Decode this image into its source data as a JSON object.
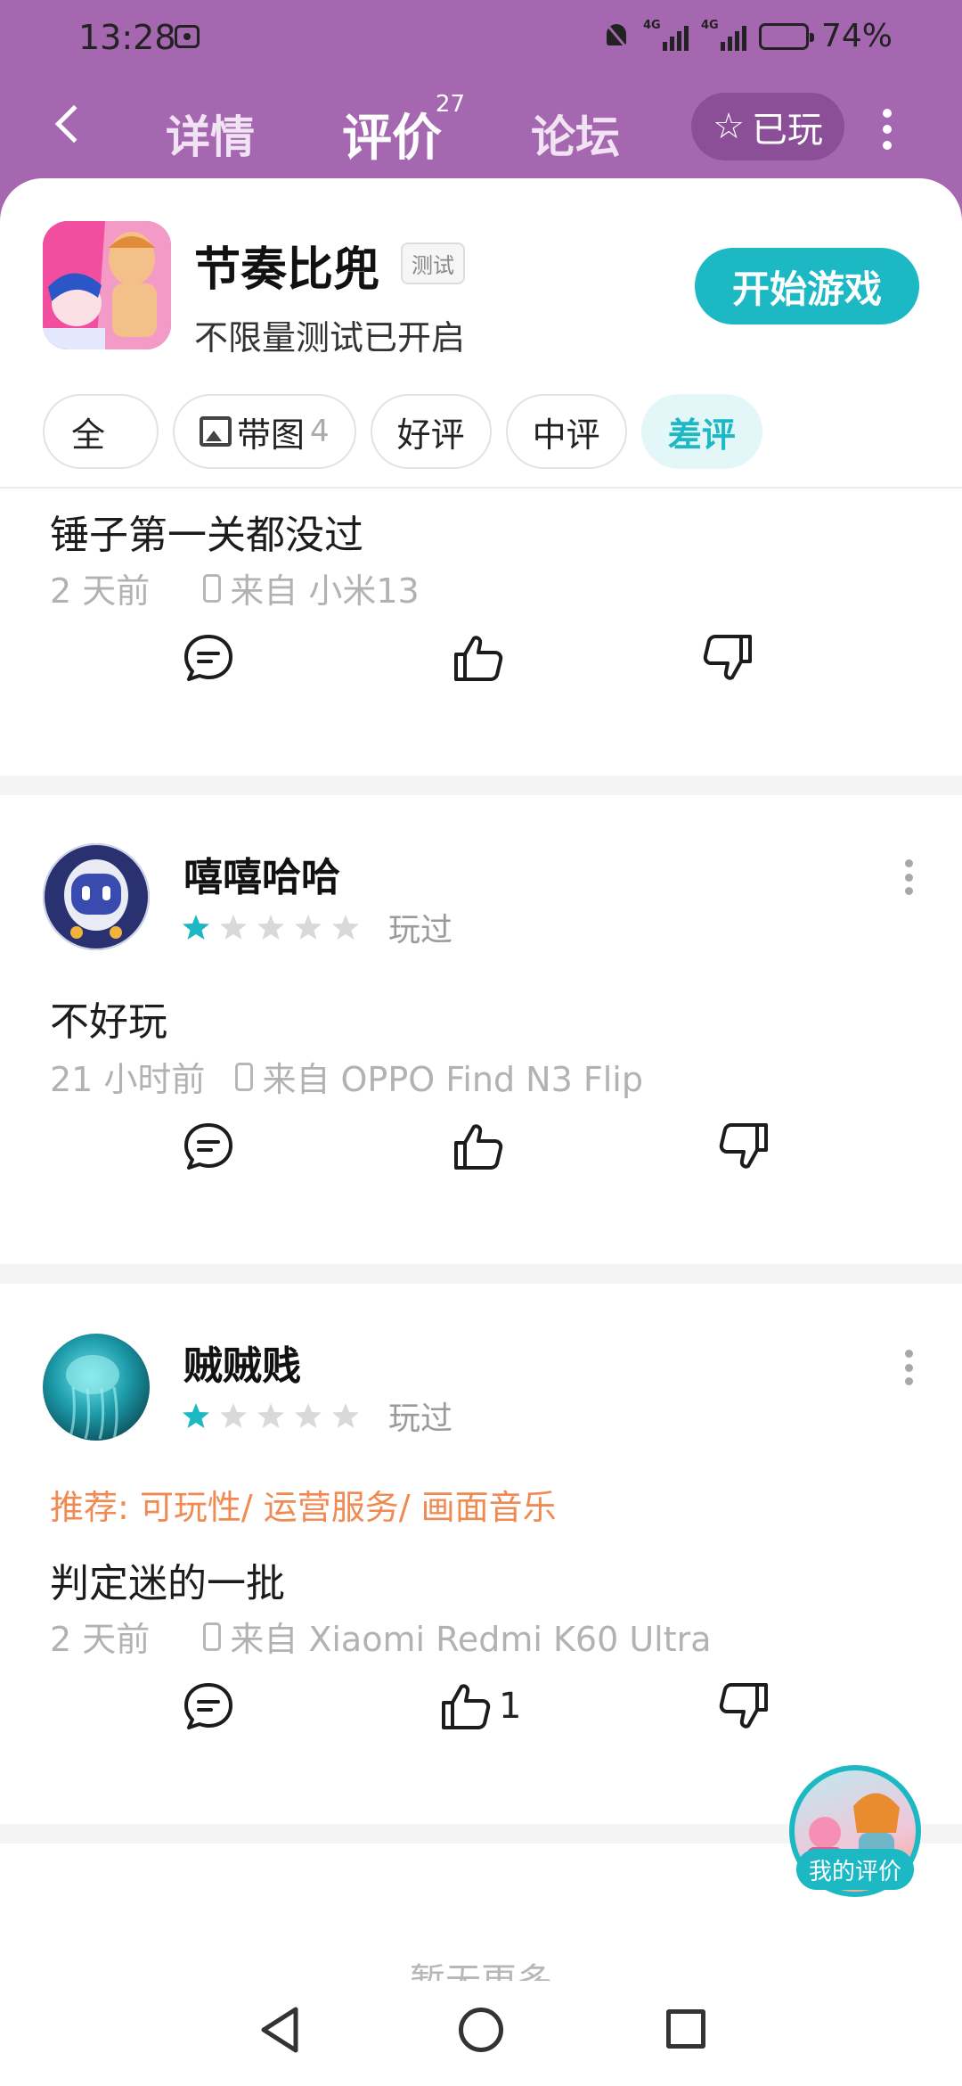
{
  "status": {
    "time": "13:28",
    "net1": "4G",
    "net2": "4G",
    "battery": "74%",
    "battery_level": 0.74
  },
  "nav": {
    "tabs": [
      {
        "label": "详情"
      },
      {
        "label": "评价",
        "count": "27"
      },
      {
        "label": "论坛"
      }
    ],
    "played_label": "已玩"
  },
  "game": {
    "title": "节奏比兜",
    "badge": "测试",
    "subtitle": "不限量测试已开启",
    "start_label": "开始游戏"
  },
  "filters": [
    {
      "label": "全"
    },
    {
      "label": "带图",
      "count": "4"
    },
    {
      "label": "好评"
    },
    {
      "label": "中评"
    },
    {
      "label": "差评"
    }
  ],
  "reviews": [
    {
      "text": "锤子第一关都没过",
      "time": "2 天前",
      "device": "来自 小米13"
    },
    {
      "user": "嘻嘻哈哈",
      "rating": 1,
      "status": "玩过",
      "text": "不好玩",
      "time": "21 小时前",
      "device": "来自 OPPO Find N3 Flip"
    },
    {
      "user": "贼贼贱",
      "rating": 1,
      "status": "玩过",
      "recommend": "推荐: 可玩性/ 运营服务/ 画面音乐",
      "text": "判定迷的一批",
      "time": "2 天前",
      "device": "来自 Xiaomi Redmi K60 Ultra",
      "likes": "1"
    }
  ],
  "load_more": "暂无更多",
  "my_review_label": "我的评价",
  "colors": {
    "header": "#a467b0",
    "accent": "#1cb8c4",
    "recommend": "#f08a52",
    "star_on": "#1cb8c4",
    "star_off": "#d9d9d9"
  }
}
